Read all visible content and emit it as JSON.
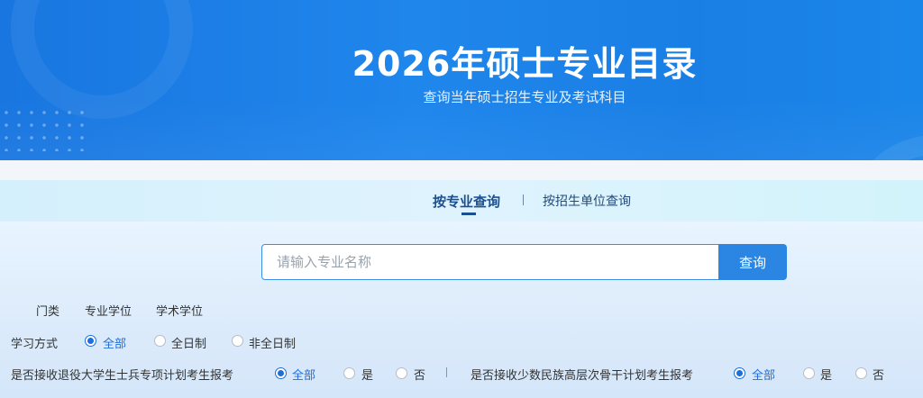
{
  "banner": {
    "title": "2026年硕士专业目录",
    "subtitle": "查询当年硕士招生专业及考试科目"
  },
  "tabs": [
    {
      "label": "按专业查询",
      "active": true
    },
    {
      "label": "按招生单位查询",
      "active": false
    }
  ],
  "search": {
    "placeholder": "请输入专业名称",
    "value": "",
    "button_label": "查询"
  },
  "filters": {
    "category": {
      "label": "门类",
      "options": [
        "专业学位",
        "学术学位"
      ]
    },
    "study_mode": {
      "label": "学习方式",
      "options": [
        "全部",
        "全日制",
        "非全日制"
      ],
      "selected": "全部"
    },
    "veteran_plan": {
      "label": "是否接收退役大学生士兵专项计划考生报考",
      "options": [
        "全部",
        "是",
        "否"
      ],
      "selected": "全部"
    },
    "minority_plan": {
      "label": "是否接收少数民族高层次骨干计划考生报考",
      "options": [
        "全部",
        "是",
        "否"
      ],
      "selected": "全部"
    }
  },
  "colors": {
    "banner_blue": "#1a7fe5",
    "accent_blue": "#1e6fd9",
    "button_blue": "#2b86e3"
  }
}
